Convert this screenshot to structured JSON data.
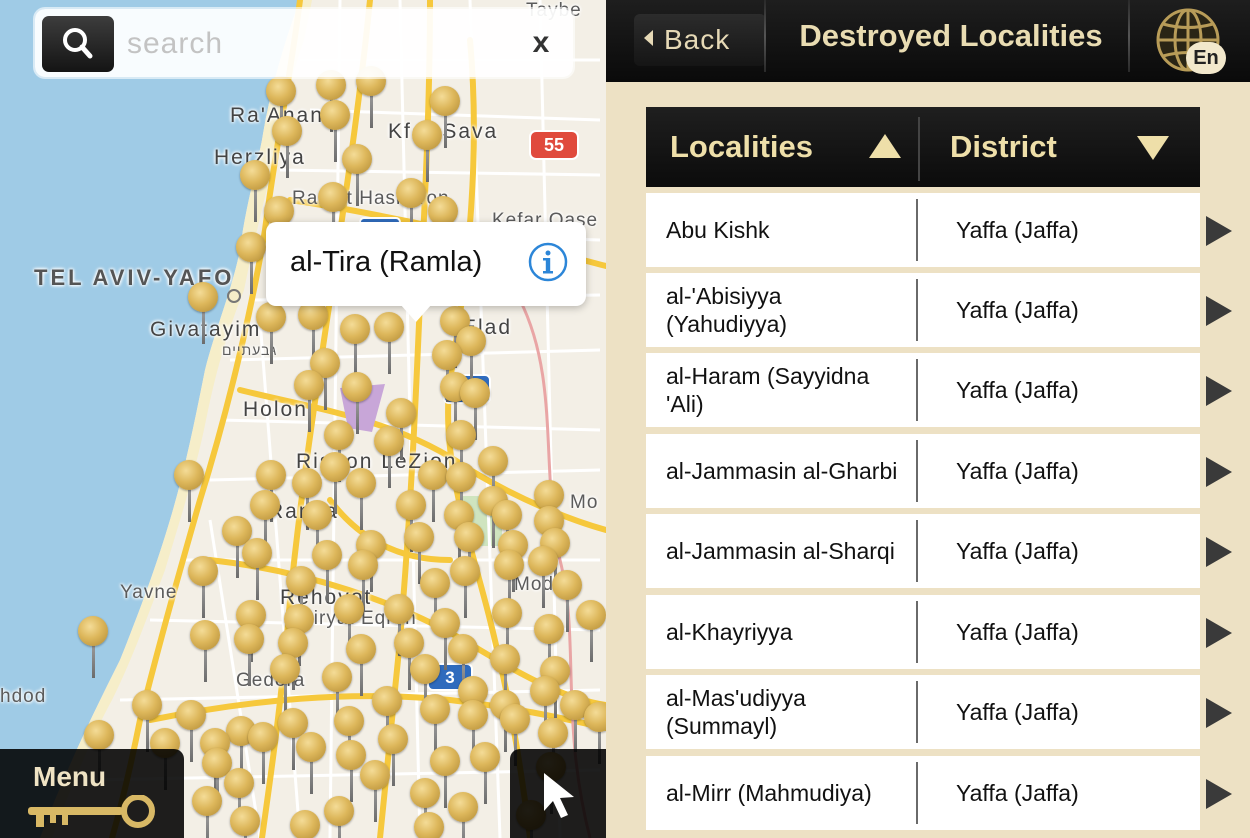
{
  "map": {
    "search": {
      "placeholder": "search"
    },
    "clear_label": "x",
    "callout": {
      "title": "al-Tira (Ramla)"
    },
    "menu_label": "Menu",
    "labels": [
      {
        "text": "Taybe"
      },
      {
        "text": "Ra'Anana"
      },
      {
        "text": "Kfar Sava"
      },
      {
        "text": "Herzliya"
      },
      {
        "text": "Ramat Hasharon"
      },
      {
        "text": "Kefar Qase"
      },
      {
        "text": "TEL AVIV-YAFO"
      },
      {
        "text": "Givatayim"
      },
      {
        "text": "גבעתיים"
      },
      {
        "text": "Elad"
      },
      {
        "text": "Holon"
      },
      {
        "text": "Rishon LeZion"
      },
      {
        "text": "Ramla"
      },
      {
        "text": "Mo"
      },
      {
        "text": "Yavne"
      },
      {
        "text": "Rehovot"
      },
      {
        "text": "Qiryat Eqron"
      },
      {
        "text": "Modi'in"
      },
      {
        "text": "Gedera"
      },
      {
        "text": "hdod"
      }
    ],
    "shields": [
      "55",
      "3"
    ]
  },
  "nav": {
    "back_label": "Back",
    "title": "Destroyed Localities",
    "lang": "En"
  },
  "table": {
    "col_localities": "Localities",
    "col_district": "District",
    "rows": [
      {
        "locality": "Abu Kishk",
        "district": "Yaffa (Jaffa)"
      },
      {
        "locality": "al-'Abisiyya (Yahudiyya)",
        "district": "Yaffa (Jaffa)"
      },
      {
        "locality": "al-Haram (Sayyidna 'Ali)",
        "district": "Yaffa (Jaffa)"
      },
      {
        "locality": "al-Jammasin al-Gharbi",
        "district": "Yaffa (Jaffa)"
      },
      {
        "locality": "al-Jammasin al-Sharqi",
        "district": "Yaffa (Jaffa)"
      },
      {
        "locality": "al-Khayriyya",
        "district": "Yaffa (Jaffa)"
      },
      {
        "locality": "al-Mas'udiyya (Summayl)",
        "district": "Yaffa (Jaffa)"
      },
      {
        "locality": "al-Mirr (Mahmudiya)",
        "district": "Yaffa (Jaffa)"
      }
    ]
  }
}
